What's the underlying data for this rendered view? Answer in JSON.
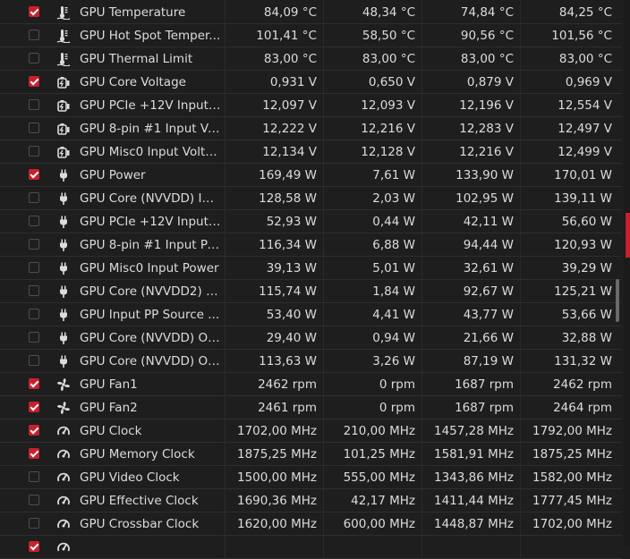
{
  "colors": {
    "accent": "#c8202d",
    "background": "#1e1e1e",
    "text": "#dcdcdc"
  },
  "rows": [
    {
      "checked": true,
      "icon": "thermometer-icon",
      "label": "GPU Temperature",
      "current": "84,09 °C",
      "min": "48,34 °C",
      "avg": "74,84 °C",
      "max": "84,25 °C"
    },
    {
      "checked": false,
      "icon": "thermometer-icon",
      "label": "GPU Hot Spot Temper...",
      "current": "101,41 °C",
      "min": "58,50 °C",
      "avg": "90,56 °C",
      "max": "101,56 °C"
    },
    {
      "checked": false,
      "icon": "thermometer-icon",
      "label": "GPU Thermal Limit",
      "current": "83,00 °C",
      "min": "83,00 °C",
      "avg": "83,00 °C",
      "max": "83,00 °C"
    },
    {
      "checked": true,
      "icon": "battery-icon",
      "label": "GPU Core Voltage",
      "current": "0,931 V",
      "min": "0,650 V",
      "avg": "0,879 V",
      "max": "0,969 V"
    },
    {
      "checked": false,
      "icon": "battery-icon",
      "label": "GPU PCIe +12V Input ...",
      "current": "12,097 V",
      "min": "12,093 V",
      "avg": "12,196 V",
      "max": "12,554 V"
    },
    {
      "checked": false,
      "icon": "battery-icon",
      "label": "GPU 8-pin #1 Input Vo...",
      "current": "12,222 V",
      "min": "12,216 V",
      "avg": "12,283 V",
      "max": "12,497 V"
    },
    {
      "checked": false,
      "icon": "battery-icon",
      "label": "GPU Misc0 Input Volta...",
      "current": "12,134 V",
      "min": "12,128 V",
      "avg": "12,216 V",
      "max": "12,499 V"
    },
    {
      "checked": true,
      "icon": "plug-icon",
      "label": "GPU Power",
      "current": "169,49 W",
      "min": "7,61 W",
      "avg": "133,90 W",
      "max": "170,01 W"
    },
    {
      "checked": false,
      "icon": "plug-icon",
      "label": "GPU Core (NVVDD) Inp...",
      "current": "128,58 W",
      "min": "2,03 W",
      "avg": "102,95 W",
      "max": "139,11 W"
    },
    {
      "checked": false,
      "icon": "plug-icon",
      "label": "GPU PCIe +12V Input ...",
      "current": "52,93 W",
      "min": "0,44 W",
      "avg": "42,11 W",
      "max": "56,60 W"
    },
    {
      "checked": false,
      "icon": "plug-icon",
      "label": "GPU 8-pin #1 Input Po...",
      "current": "116,34 W",
      "min": "6,88 W",
      "avg": "94,44 W",
      "max": "120,93 W"
    },
    {
      "checked": false,
      "icon": "plug-icon",
      "label": "GPU Misc0 Input Power",
      "current": "39,13 W",
      "min": "5,01 W",
      "avg": "32,61 W",
      "max": "39,29 W"
    },
    {
      "checked": false,
      "icon": "plug-icon",
      "label": "GPU Core (NVVDD2) In...",
      "current": "115,74 W",
      "min": "1,84 W",
      "avg": "92,67 W",
      "max": "125,21 W"
    },
    {
      "checked": false,
      "icon": "plug-icon",
      "label": "GPU Input PP Source ...",
      "current": "53,40 W",
      "min": "4,41 W",
      "avg": "43,77 W",
      "max": "53,66 W"
    },
    {
      "checked": false,
      "icon": "plug-icon",
      "label": "GPU Core (NVVDD) Ou...",
      "current": "29,40 W",
      "min": "0,94 W",
      "avg": "21,66 W",
      "max": "32,88 W"
    },
    {
      "checked": false,
      "icon": "plug-icon",
      "label": "GPU Core (NVVDD) Ou...",
      "current": "113,63 W",
      "min": "3,26 W",
      "avg": "87,19 W",
      "max": "131,32 W"
    },
    {
      "checked": true,
      "icon": "fan-icon",
      "label": "GPU Fan1",
      "current": "2462 rpm",
      "min": "0 rpm",
      "avg": "1687 rpm",
      "max": "2462 rpm"
    },
    {
      "checked": true,
      "icon": "fan-icon",
      "label": "GPU Fan2",
      "current": "2461 rpm",
      "min": "0 rpm",
      "avg": "1687 rpm",
      "max": "2464 rpm"
    },
    {
      "checked": true,
      "icon": "gauge-icon",
      "label": "GPU Clock",
      "current": "1702,00 MHz",
      "min": "210,00 MHz",
      "avg": "1457,28 MHz",
      "max": "1792,00 MHz"
    },
    {
      "checked": true,
      "icon": "gauge-icon",
      "label": "GPU Memory Clock",
      "current": "1875,25 MHz",
      "min": "101,25 MHz",
      "avg": "1581,91 MHz",
      "max": "1875,25 MHz"
    },
    {
      "checked": false,
      "icon": "gauge-icon",
      "label": "GPU Video Clock",
      "current": "1500,00 MHz",
      "min": "555,00 MHz",
      "avg": "1343,86 MHz",
      "max": "1582,00 MHz"
    },
    {
      "checked": false,
      "icon": "gauge-icon",
      "label": "GPU Effective Clock",
      "current": "1690,36 MHz",
      "min": "42,17 MHz",
      "avg": "1411,44 MHz",
      "max": "1777,45 MHz"
    },
    {
      "checked": false,
      "icon": "gauge-icon",
      "label": "GPU Crossbar Clock",
      "current": "1620,00 MHz",
      "min": "600,00 MHz",
      "avg": "1448,87 MHz",
      "max": "1702,00 MHz"
    },
    {
      "checked": true,
      "icon": "gauge-icon",
      "label": "",
      "current": "",
      "min": "",
      "avg": "",
      "max": ""
    }
  ]
}
